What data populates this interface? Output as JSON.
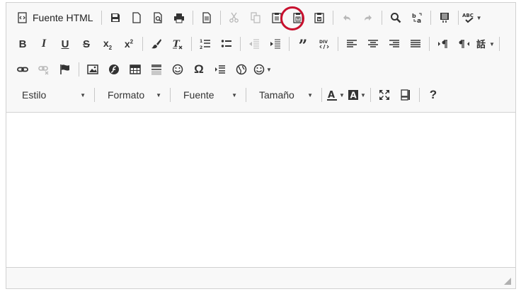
{
  "toolbar": {
    "row1": {
      "source_label": "Fuente HTML"
    },
    "row4": {
      "style_combo": "Estilo",
      "format_combo": "Formato",
      "font_combo": "Fuente",
      "size_combo": "Tamaño",
      "help_label": "?"
    }
  },
  "colors": {
    "highlight": "#c8102e",
    "toolbar_bg": "#f8f8f8",
    "border": "#d1d1d1"
  }
}
